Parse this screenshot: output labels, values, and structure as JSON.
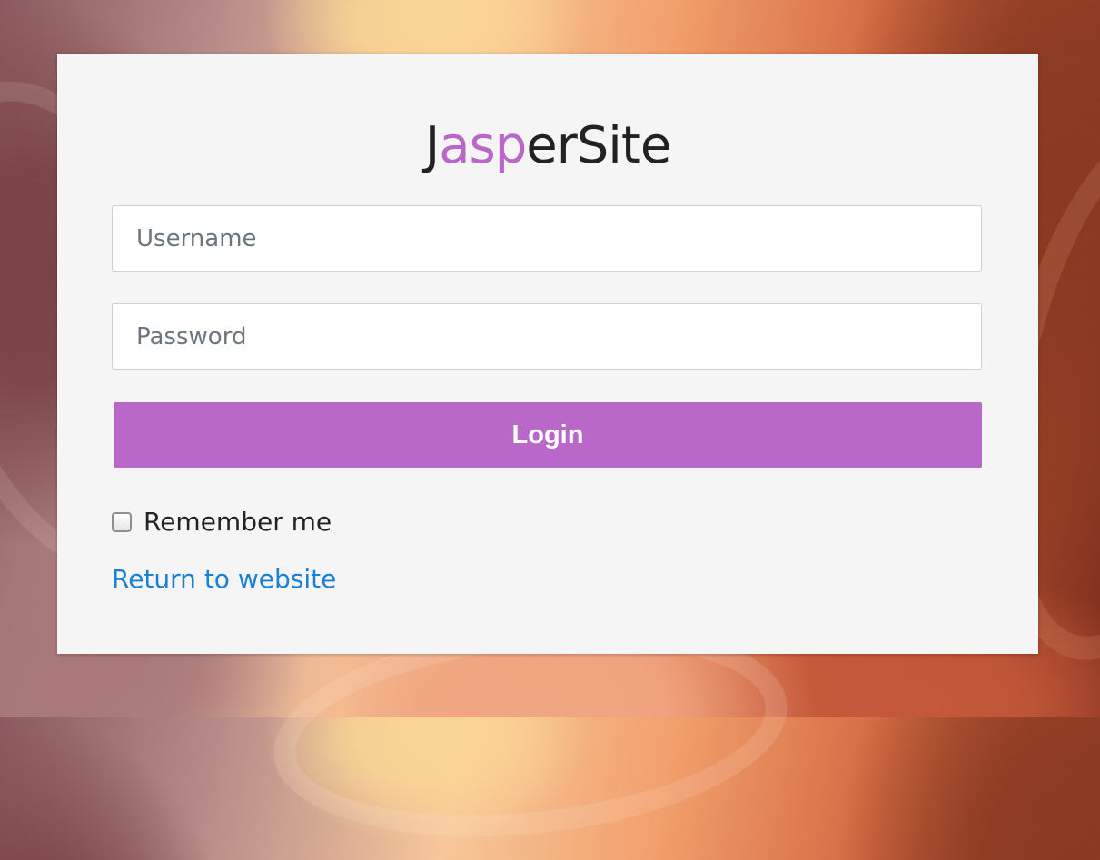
{
  "brand": {
    "prefix": "J",
    "accent": "asp",
    "suffix": "erSite",
    "accent_color": "#b967c8"
  },
  "form": {
    "username_placeholder": "Username",
    "username_value": "",
    "password_placeholder": "Password",
    "password_value": "",
    "login_label": "Login",
    "remember_label": "Remember me",
    "remember_checked": false,
    "return_link": "Return to website"
  },
  "colors": {
    "button": "#b967c8",
    "link": "#1a7fd6",
    "card": "#f5f5f5"
  }
}
